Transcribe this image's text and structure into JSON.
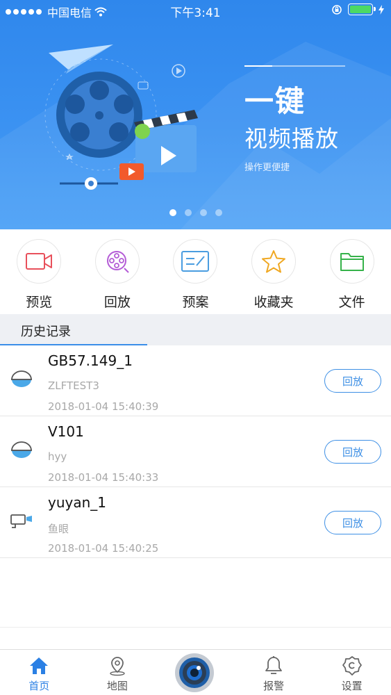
{
  "status_bar": {
    "carrier": "中国电信",
    "time": "下午3:41"
  },
  "banner": {
    "title": "一键",
    "subtitle": "视频播放",
    "caption": "操作更便捷",
    "page_count": 4,
    "active_page": 1
  },
  "quick_menu": [
    {
      "label": "预览",
      "icon": "video-camera-icon",
      "color": "#e8505b"
    },
    {
      "label": "回放",
      "icon": "film-reel-icon",
      "color": "#b45cd6"
    },
    {
      "label": "预案",
      "icon": "plan-icon",
      "color": "#4a9de0"
    },
    {
      "label": "收藏夹",
      "icon": "star-icon",
      "color": "#f0a822"
    },
    {
      "label": "文件",
      "icon": "folder-icon",
      "color": "#36b24a"
    }
  ],
  "history": {
    "title": "历史记录",
    "items": [
      {
        "name": "GB57.149_1",
        "sub": "ZLFTEST3",
        "time": "2018-01-04 15:40:39",
        "button": "回放",
        "icon": "dome-camera-icon"
      },
      {
        "name": "V101",
        "sub": "hyy",
        "time": "2018-01-04 15:40:33",
        "button": "回放",
        "icon": "dome-camera-icon"
      },
      {
        "name": "yuyan_1",
        "sub": "鱼眼",
        "time": "2018-01-04 15:40:25",
        "button": "回放",
        "icon": "bullet-camera-icon"
      }
    ]
  },
  "tab_bar": {
    "items": [
      {
        "label": "首页",
        "icon": "home-icon",
        "active": true
      },
      {
        "label": "地图",
        "icon": "map-pin-icon",
        "active": false
      },
      {
        "label": "",
        "icon": "camera-button-icon",
        "active": false
      },
      {
        "label": "报警",
        "icon": "bell-icon",
        "active": false
      },
      {
        "label": "设置",
        "icon": "gear-icon",
        "active": false
      }
    ]
  },
  "colors": {
    "accent": "#2b80e4",
    "banner_top": "#2f87ec",
    "banner_bottom": "#4aa0f6"
  }
}
